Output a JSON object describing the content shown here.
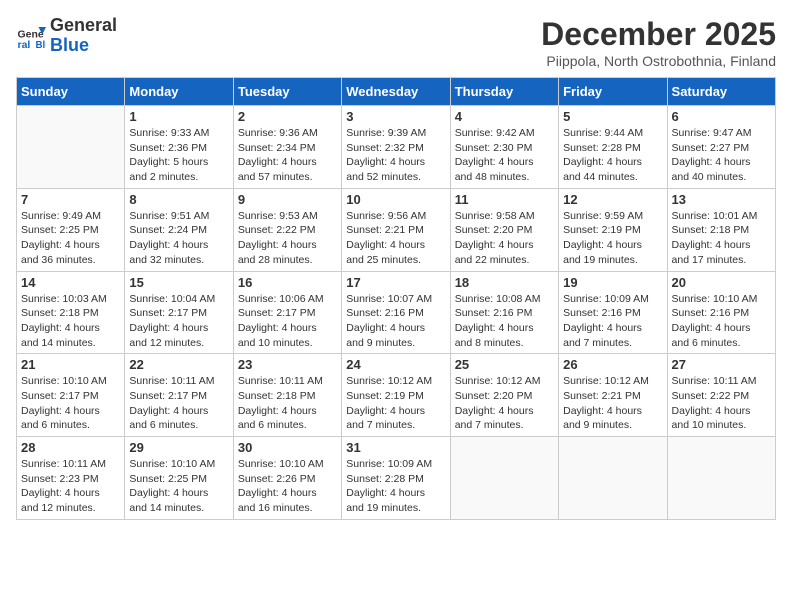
{
  "logo": {
    "general": "General",
    "blue": "Blue"
  },
  "title": "December 2025",
  "subtitle": "Piippola, North Ostrobothnia, Finland",
  "days_header": [
    "Sunday",
    "Monday",
    "Tuesday",
    "Wednesday",
    "Thursday",
    "Friday",
    "Saturday"
  ],
  "weeks": [
    [
      {
        "day": "",
        "text": ""
      },
      {
        "day": "1",
        "text": "Sunrise: 9:33 AM\nSunset: 2:36 PM\nDaylight: 5 hours\nand 2 minutes."
      },
      {
        "day": "2",
        "text": "Sunrise: 9:36 AM\nSunset: 2:34 PM\nDaylight: 4 hours\nand 57 minutes."
      },
      {
        "day": "3",
        "text": "Sunrise: 9:39 AM\nSunset: 2:32 PM\nDaylight: 4 hours\nand 52 minutes."
      },
      {
        "day": "4",
        "text": "Sunrise: 9:42 AM\nSunset: 2:30 PM\nDaylight: 4 hours\nand 48 minutes."
      },
      {
        "day": "5",
        "text": "Sunrise: 9:44 AM\nSunset: 2:28 PM\nDaylight: 4 hours\nand 44 minutes."
      },
      {
        "day": "6",
        "text": "Sunrise: 9:47 AM\nSunset: 2:27 PM\nDaylight: 4 hours\nand 40 minutes."
      }
    ],
    [
      {
        "day": "7",
        "text": "Sunrise: 9:49 AM\nSunset: 2:25 PM\nDaylight: 4 hours\nand 36 minutes."
      },
      {
        "day": "8",
        "text": "Sunrise: 9:51 AM\nSunset: 2:24 PM\nDaylight: 4 hours\nand 32 minutes."
      },
      {
        "day": "9",
        "text": "Sunrise: 9:53 AM\nSunset: 2:22 PM\nDaylight: 4 hours\nand 28 minutes."
      },
      {
        "day": "10",
        "text": "Sunrise: 9:56 AM\nSunset: 2:21 PM\nDaylight: 4 hours\nand 25 minutes."
      },
      {
        "day": "11",
        "text": "Sunrise: 9:58 AM\nSunset: 2:20 PM\nDaylight: 4 hours\nand 22 minutes."
      },
      {
        "day": "12",
        "text": "Sunrise: 9:59 AM\nSunset: 2:19 PM\nDaylight: 4 hours\nand 19 minutes."
      },
      {
        "day": "13",
        "text": "Sunrise: 10:01 AM\nSunset: 2:18 PM\nDaylight: 4 hours\nand 17 minutes."
      }
    ],
    [
      {
        "day": "14",
        "text": "Sunrise: 10:03 AM\nSunset: 2:18 PM\nDaylight: 4 hours\nand 14 minutes."
      },
      {
        "day": "15",
        "text": "Sunrise: 10:04 AM\nSunset: 2:17 PM\nDaylight: 4 hours\nand 12 minutes."
      },
      {
        "day": "16",
        "text": "Sunrise: 10:06 AM\nSunset: 2:17 PM\nDaylight: 4 hours\nand 10 minutes."
      },
      {
        "day": "17",
        "text": "Sunrise: 10:07 AM\nSunset: 2:16 PM\nDaylight: 4 hours\nand 9 minutes."
      },
      {
        "day": "18",
        "text": "Sunrise: 10:08 AM\nSunset: 2:16 PM\nDaylight: 4 hours\nand 8 minutes."
      },
      {
        "day": "19",
        "text": "Sunrise: 10:09 AM\nSunset: 2:16 PM\nDaylight: 4 hours\nand 7 minutes."
      },
      {
        "day": "20",
        "text": "Sunrise: 10:10 AM\nSunset: 2:16 PM\nDaylight: 4 hours\nand 6 minutes."
      }
    ],
    [
      {
        "day": "21",
        "text": "Sunrise: 10:10 AM\nSunset: 2:17 PM\nDaylight: 4 hours\nand 6 minutes."
      },
      {
        "day": "22",
        "text": "Sunrise: 10:11 AM\nSunset: 2:17 PM\nDaylight: 4 hours\nand 6 minutes."
      },
      {
        "day": "23",
        "text": "Sunrise: 10:11 AM\nSunset: 2:18 PM\nDaylight: 4 hours\nand 6 minutes."
      },
      {
        "day": "24",
        "text": "Sunrise: 10:12 AM\nSunset: 2:19 PM\nDaylight: 4 hours\nand 7 minutes."
      },
      {
        "day": "25",
        "text": "Sunrise: 10:12 AM\nSunset: 2:20 PM\nDaylight: 4 hours\nand 7 minutes."
      },
      {
        "day": "26",
        "text": "Sunrise: 10:12 AM\nSunset: 2:21 PM\nDaylight: 4 hours\nand 9 minutes."
      },
      {
        "day": "27",
        "text": "Sunrise: 10:11 AM\nSunset: 2:22 PM\nDaylight: 4 hours\nand 10 minutes."
      }
    ],
    [
      {
        "day": "28",
        "text": "Sunrise: 10:11 AM\nSunset: 2:23 PM\nDaylight: 4 hours\nand 12 minutes."
      },
      {
        "day": "29",
        "text": "Sunrise: 10:10 AM\nSunset: 2:25 PM\nDaylight: 4 hours\nand 14 minutes."
      },
      {
        "day": "30",
        "text": "Sunrise: 10:10 AM\nSunset: 2:26 PM\nDaylight: 4 hours\nand 16 minutes."
      },
      {
        "day": "31",
        "text": "Sunrise: 10:09 AM\nSunset: 2:28 PM\nDaylight: 4 hours\nand 19 minutes."
      },
      {
        "day": "",
        "text": ""
      },
      {
        "day": "",
        "text": ""
      },
      {
        "day": "",
        "text": ""
      }
    ]
  ]
}
